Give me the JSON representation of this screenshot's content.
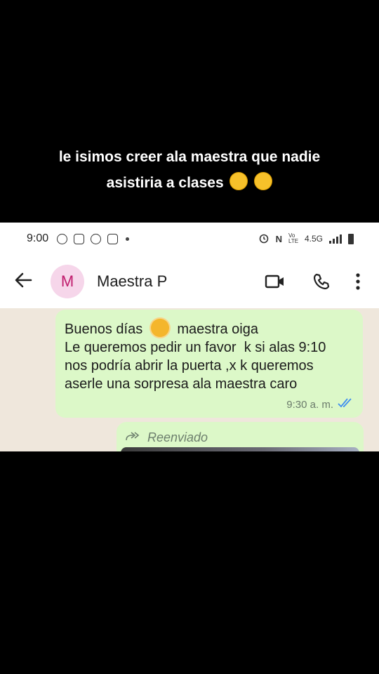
{
  "caption": {
    "line1": "le isimos creer ala maestra que nadie",
    "line2": "asistiria a clases"
  },
  "status_bar": {
    "time": "9:00",
    "network": "4.5G",
    "volte": "Vo LTE"
  },
  "header": {
    "avatar_letter": "M",
    "contact_name": "Maestra P"
  },
  "message": {
    "line1_a": "Buenos días",
    "line1_b": "maestra oiga",
    "line2": "Le queremos pedir un favor  k si alas 9:10",
    "line3": "nos podría abrir la puerta ,x k queremos",
    "line4": "aserle una sorpresa ala maestra caro",
    "time": "9:30 a. m."
  },
  "forwarded": {
    "label": "Reenviado"
  },
  "colors": {
    "bubble": "#dcf8c8",
    "chat_bg": "#efe7dc",
    "read_ticks": "#3f8ef0",
    "avatar_bg": "#f6d6ea",
    "avatar_fg": "#c01c6d"
  }
}
